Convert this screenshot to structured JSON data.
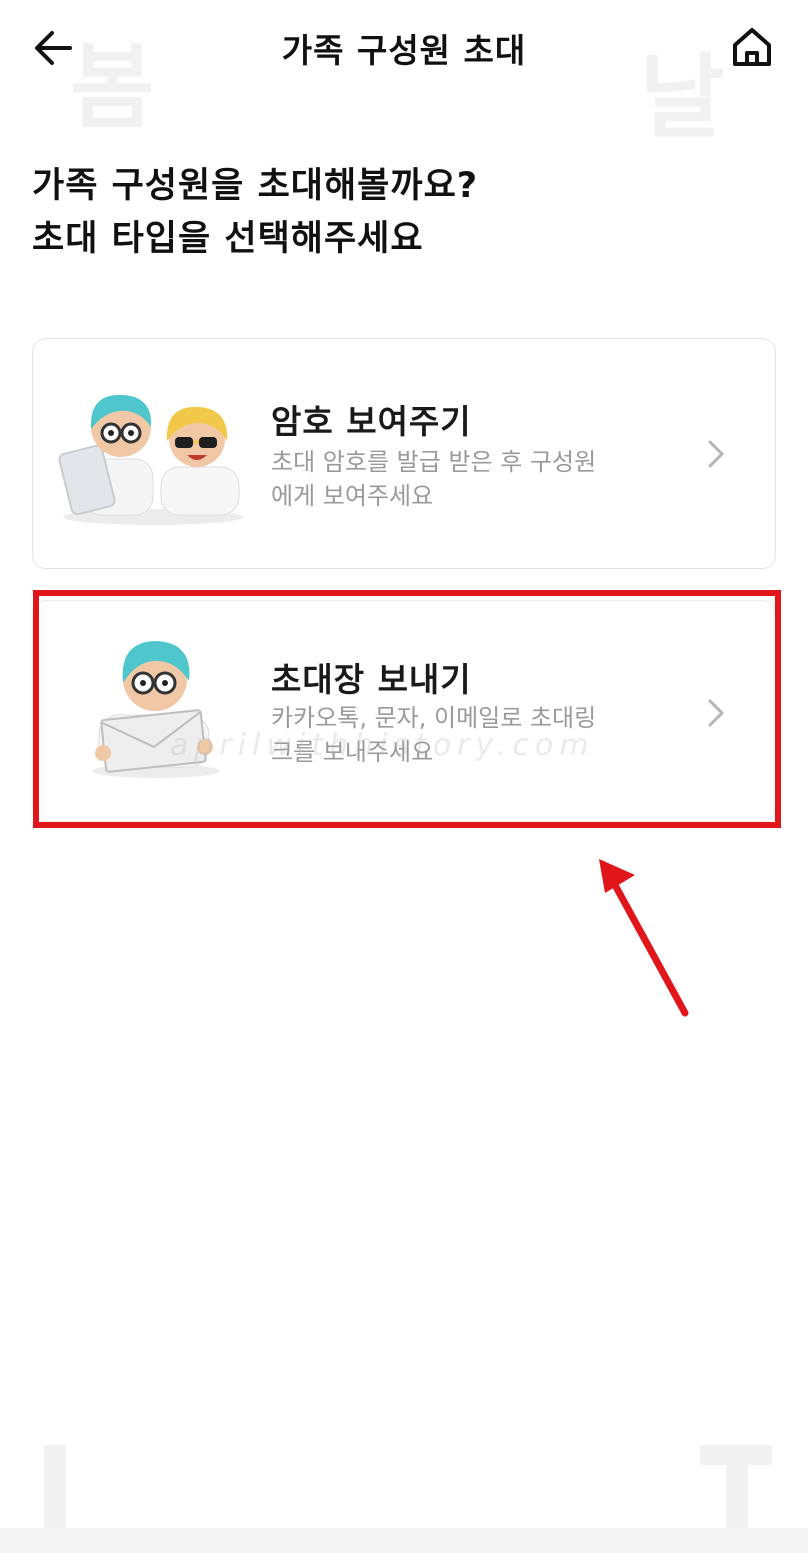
{
  "header": {
    "title": "가족 구성원 초대"
  },
  "background_watermarks": [
    "봄",
    "날"
  ],
  "heading": {
    "line1": "가족 구성원을 초대해볼까요?",
    "line2": "초대 타입을 선택해주세요"
  },
  "options": [
    {
      "title": "암호 보여주기",
      "description_line1": "초대 암호를 발급 받은 후 구성원",
      "description_line2": "에게 보여주세요"
    },
    {
      "title": "초대장 보내기",
      "description_line1": "카카오톡, 문자, 이메일로 초대링",
      "description_line2": "크를 보내주세요"
    }
  ],
  "watermark": "aprilwithhistory.com",
  "colors": {
    "highlight": "#e0161b",
    "title_text": "#111111",
    "description_text": "#9a9a9a",
    "card_border": "#e3e3e3",
    "character_hair": "#4ec6cc",
    "character_hair_2": "#f2c84b"
  },
  "icons": {
    "back": "arrow-left-icon",
    "home": "home-icon",
    "option_chevron": "chevron-right-icon"
  }
}
